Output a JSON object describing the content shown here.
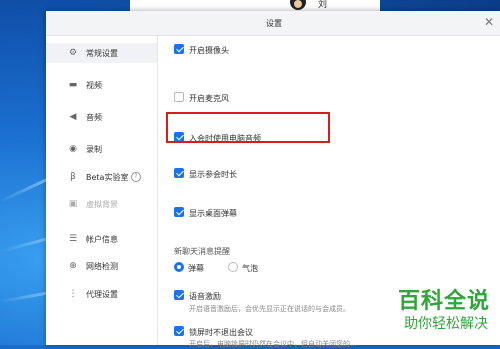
{
  "top_user": {
    "name": "刘"
  },
  "dialog": {
    "title": "设置",
    "close_glyph": "✕"
  },
  "sidebar": {
    "items": [
      {
        "label": "常规设置",
        "icon": "gear-icon",
        "glyph": "⚙",
        "active": true
      },
      {
        "label": "视频",
        "icon": "video-camera-icon",
        "glyph": "▬"
      },
      {
        "label": "音频",
        "icon": "speaker-icon",
        "glyph": "◀"
      },
      {
        "label": "录制",
        "icon": "record-icon",
        "glyph": "◉"
      },
      {
        "label": "Beta实验室",
        "icon": "beta-lab-icon",
        "glyph": "β"
      },
      {
        "label": "虚拟背景",
        "icon": "virtual-background-icon",
        "glyph": "▣",
        "disabled": true
      },
      {
        "label": "帐户信息",
        "icon": "account-icon",
        "glyph": "☰"
      },
      {
        "label": "网络检测",
        "icon": "network-icon",
        "glyph": "⊕"
      },
      {
        "label": "代理设置",
        "icon": "proxy-icon",
        "glyph": "⋮"
      }
    ],
    "help_glyph": "?"
  },
  "general": {
    "options": [
      {
        "label": "开启摄像头",
        "checked": true
      },
      {
        "label": "开启麦克风",
        "checked": false
      },
      {
        "label": "入会时使用电脑音频",
        "checked": true
      },
      {
        "label": "显示参会时长",
        "checked": true
      },
      {
        "label": "显示桌面弹幕",
        "checked": true
      }
    ],
    "chat_reminder_label": "新聊天消息提醒",
    "chat_reminder_options": [
      {
        "label": "弹幕",
        "selected": true
      },
      {
        "label": "气泡",
        "selected": false
      }
    ],
    "voice_motivation": {
      "label": "语音激励",
      "checked": true,
      "desc": "开启语音激励后，会优先显示正在说话的与会成员。"
    },
    "lock_screen": {
      "label": "锁屏时不退出会议",
      "checked": true,
      "desc": "开启后，电脑锁屏时仍然在会议中，但自动关闭您的..."
    }
  },
  "watermark": {
    "main": "百科全说",
    "sub": "助你轻松解决"
  },
  "colors": {
    "accent": "#1a73e8",
    "highlight": "#e0191c",
    "watermark": "#2fa53a"
  }
}
